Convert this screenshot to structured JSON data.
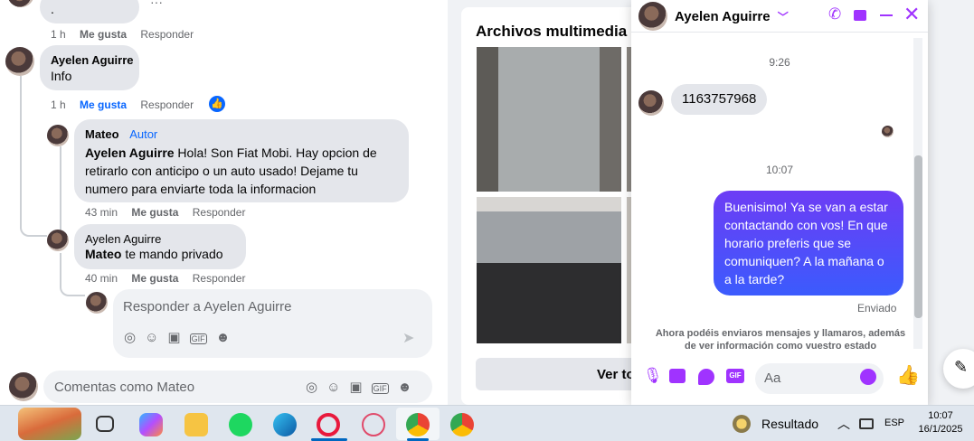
{
  "comments": {
    "top_dot": ".",
    "top_more": "···",
    "row1": {
      "time": "1 h",
      "like": "Me gusta",
      "reply": "Responder"
    },
    "c2": {
      "name": "Ayelen Aguirre",
      "text": "Info",
      "time": "1 h",
      "like": "Me gusta",
      "reply": "Responder"
    },
    "c3": {
      "name": "Mateo",
      "badge": "Autor",
      "mention": "Ayelen Aguirre",
      "text": " Hola! Son Fiat Mobi. Hay opcion de retirarlo con anticipo o un auto usado! Dejame tu numero para enviarte toda la informacion",
      "time": "43 min",
      "like": "Me gusta",
      "reply": "Responder"
    },
    "c4": {
      "name": "Ayelen Aguirre",
      "mention": "Mateo",
      "text": " te mando privado",
      "time": "40 min",
      "like": "Me gusta",
      "reply": "Responder"
    },
    "reply_placeholder": "Responder a Ayelen Aguirre",
    "main_placeholder": "Comentas como Mateo"
  },
  "media": {
    "title": "Archivos multimedia re",
    "button": "Ver to"
  },
  "chat": {
    "name": "Ayelen Aguirre",
    "time1": "9:26",
    "msg_in": "1163757968",
    "time2": "10:07",
    "msg_out": "Buenisimo! Ya se van a estar contactando con vos! En que horario preferis que se comuniquen? A la mañana o a la tarde?",
    "status": "Enviado",
    "notice": "Ahora podéis enviaros mensajes y llamaros, además de ver información como vuestro estado",
    "input_placeholder": "Aa",
    "accent": "#a033ff",
    "bubble_color": "#3b5bfd"
  },
  "taskbar": {
    "weather": "Resultado",
    "lang": "ESP",
    "time": "10:07",
    "date": "16/1/2025"
  }
}
